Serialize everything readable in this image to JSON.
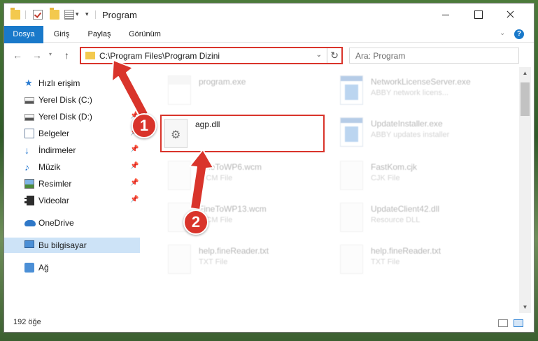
{
  "window": {
    "title": "Program"
  },
  "ribbon": {
    "tabs": [
      {
        "label": "Dosya"
      },
      {
        "label": "Giriş"
      },
      {
        "label": "Paylaş"
      },
      {
        "label": "Görünüm"
      }
    ]
  },
  "address": {
    "path": "C:\\Program Files\\Program Dizini"
  },
  "search": {
    "placeholder": "Ara: Program"
  },
  "sidebar": {
    "items": [
      {
        "label": "Hızlı erişim"
      },
      {
        "label": "Yerel Disk (C:)"
      },
      {
        "label": "Yerel Disk (D:)"
      },
      {
        "label": "Belgeler"
      },
      {
        "label": "İndirmeler"
      },
      {
        "label": "Müzik"
      },
      {
        "label": "Resimler"
      },
      {
        "label": "Videolar"
      },
      {
        "label": "OneDrive"
      },
      {
        "label": "Bu bilgisayar"
      },
      {
        "label": "Ağ"
      }
    ]
  },
  "files": {
    "col1": [
      {
        "name": "program.exe",
        "sub": ""
      },
      {
        "name": "agp.dll",
        "sub": ""
      },
      {
        "name": "FineToWP6.wcm",
        "sub": "WCM File"
      },
      {
        "name": "FineToWP13.wcm",
        "sub": "WCM File"
      },
      {
        "name": "help.fineReader.txt",
        "sub": "TXT File"
      }
    ],
    "col2": [
      {
        "name": "NetworkLicenseServer.exe",
        "sub": "ABBY network licens..."
      },
      {
        "name": "UpdateInstaller.exe",
        "sub": "ABBY updates installer"
      },
      {
        "name": "FastKom.cjk",
        "sub": "CJK File"
      },
      {
        "name": "UpdateClient42.dll",
        "sub": "Resource DLL"
      },
      {
        "name": "help.fineReader.txt",
        "sub": "TXT File"
      }
    ]
  },
  "status": {
    "count": "192 öğe"
  },
  "annotations": {
    "step1": "1",
    "step2": "2"
  },
  "colors": {
    "accent": "#1979ca",
    "highlight": "#d9342b"
  }
}
